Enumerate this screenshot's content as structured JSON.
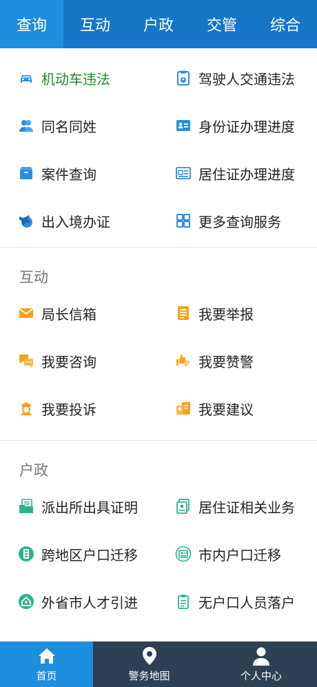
{
  "top_tabs": [
    "查询",
    "互动",
    "户政",
    "交管",
    "综合"
  ],
  "query_section": {
    "items": [
      {
        "label": "机动车违法",
        "icon": "car-icon"
      },
      {
        "label": "驾驶人交通违法",
        "icon": "license-clipboard-icon"
      },
      {
        "label": "同名同姓",
        "icon": "people-icon"
      },
      {
        "label": "身份证办理进度",
        "icon": "id-card-icon"
      },
      {
        "label": "案件查询",
        "icon": "box-icon"
      },
      {
        "label": "居住证办理进度",
        "icon": "residence-card-icon"
      },
      {
        "label": "出入境办证",
        "icon": "plane-globe-icon"
      },
      {
        "label": "更多查询服务",
        "icon": "grid-icon"
      }
    ]
  },
  "interact_section": {
    "title": "互动",
    "items": [
      {
        "label": "局长信箱",
        "icon": "envelope-icon"
      },
      {
        "label": "我要举报",
        "icon": "document-icon"
      },
      {
        "label": "我要咨询",
        "icon": "chat-icon"
      },
      {
        "label": "我要赞警",
        "icon": "thumbs-icon"
      },
      {
        "label": "我要投诉",
        "icon": "police-officer-icon"
      },
      {
        "label": "我要建议",
        "icon": "lightbulb-doc-icon"
      }
    ]
  },
  "household_section": {
    "title": "户政",
    "items": [
      {
        "label": "派出所出具证明",
        "icon": "folder-doc-icon"
      },
      {
        "label": "居住证相关业务",
        "icon": "card-stack-icon"
      },
      {
        "label": "跨地区户口迁移",
        "icon": "building-circle-icon"
      },
      {
        "label": "市内户口迁移",
        "icon": "badge-circle-icon"
      },
      {
        "label": "外省市人才引进",
        "icon": "house-circle-icon"
      },
      {
        "label": "无户口人员落户",
        "icon": "clipboard-list-icon"
      }
    ]
  },
  "bottom_nav": [
    {
      "label": "首页",
      "icon": "home-icon"
    },
    {
      "label": "警务地图",
      "icon": "map-pin-icon"
    },
    {
      "label": "个人中心",
      "icon": "user-icon"
    }
  ],
  "colors": {
    "tab_bar": "#1677c8",
    "tab_active": "#1e8fdc",
    "bottom_nav": "#2f3f54",
    "icon_blue": "#2a8de0",
    "icon_orange": "#f5a21b",
    "icon_green": "#2bb38c",
    "highlight_label": "#1e8b2a"
  }
}
